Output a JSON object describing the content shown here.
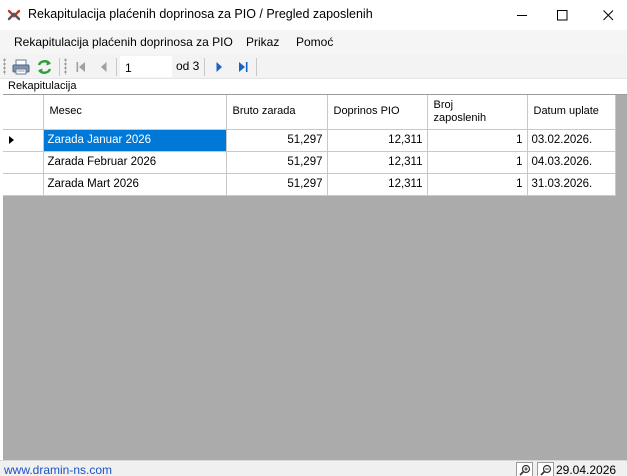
{
  "window": {
    "title": "Rekapitulacija plaćenih doprinosa za PIO / Pregled zaposlenih",
    "icon": "app-logo-icon"
  },
  "menu": {
    "items": [
      "Rekapitulacija plaćenih doprinosa za PIO",
      "Prikaz",
      "Pomoć"
    ]
  },
  "toolbar": {
    "current_page": "1",
    "page_of": "od 3"
  },
  "group_label": "Rekapitulacija",
  "grid": {
    "columns": [
      "Mesec",
      "Bruto zarada",
      "Doprinos PIO",
      "Broj\nzaposlenih",
      "Datum uplate"
    ],
    "column_broj_line1": "Broj",
    "column_broj_line2": "zaposlenih",
    "rows": [
      {
        "mesec": "Zarada Januar 2026",
        "bruto": "51,297",
        "doprinos": "12,311",
        "broj": "1",
        "datum": "03.02.2026."
      },
      {
        "mesec": "Zarada Februar 2026",
        "bruto": "51,297",
        "doprinos": "12,311",
        "broj": "1",
        "datum": "04.03.2026."
      },
      {
        "mesec": "Zarada Mart 2026",
        "bruto": "51,297",
        "doprinos": "12,311",
        "broj": "1",
        "datum": "31.03.2026."
      }
    ],
    "selected_row": 0,
    "selection_color": "#0078d7",
    "empty_area_color": "#ababab"
  },
  "status": {
    "link": "www.dramin-ns.com",
    "date": "29.04.2026",
    "link_color": "#1a53c7"
  }
}
